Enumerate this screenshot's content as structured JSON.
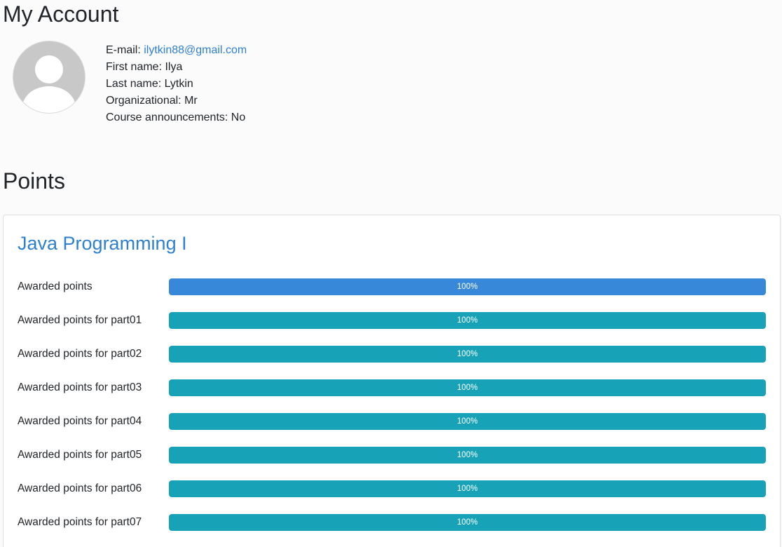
{
  "page": {
    "title": "My Account"
  },
  "profile": {
    "email_label": "E-mail:",
    "email": "ilytkin88@gmail.com",
    "first_name_label": "First name:",
    "first_name": "Ilya",
    "last_name_label": "Last name:",
    "last_name": "Lytkin",
    "organizational_label": "Organizational:",
    "organizational": "Mr",
    "course_announcements_label": "Course announcements:",
    "course_announcements": "No",
    "avatar_icon": "user-avatar-icon"
  },
  "points": {
    "heading": "Points",
    "course_title": "Java Programming I",
    "rows": [
      {
        "label": "Awarded points",
        "percent": 100,
        "display": "100%",
        "color": "#3788d8"
      },
      {
        "label": "Awarded points for part01",
        "percent": 100,
        "display": "100%",
        "color": "#17a2b8"
      },
      {
        "label": "Awarded points for part02",
        "percent": 100,
        "display": "100%",
        "color": "#17a2b8"
      },
      {
        "label": "Awarded points for part03",
        "percent": 100,
        "display": "100%",
        "color": "#17a2b8"
      },
      {
        "label": "Awarded points for part04",
        "percent": 100,
        "display": "100%",
        "color": "#17a2b8"
      },
      {
        "label": "Awarded points for part05",
        "percent": 100,
        "display": "100%",
        "color": "#17a2b8"
      },
      {
        "label": "Awarded points for part06",
        "percent": 100,
        "display": "100%",
        "color": "#17a2b8"
      },
      {
        "label": "Awarded points for part07",
        "percent": 100,
        "display": "100%",
        "color": "#17a2b8"
      }
    ]
  },
  "colors": {
    "link": "#2f80d1",
    "total_bar": "#3788d8",
    "part_bar": "#17a2b8"
  }
}
